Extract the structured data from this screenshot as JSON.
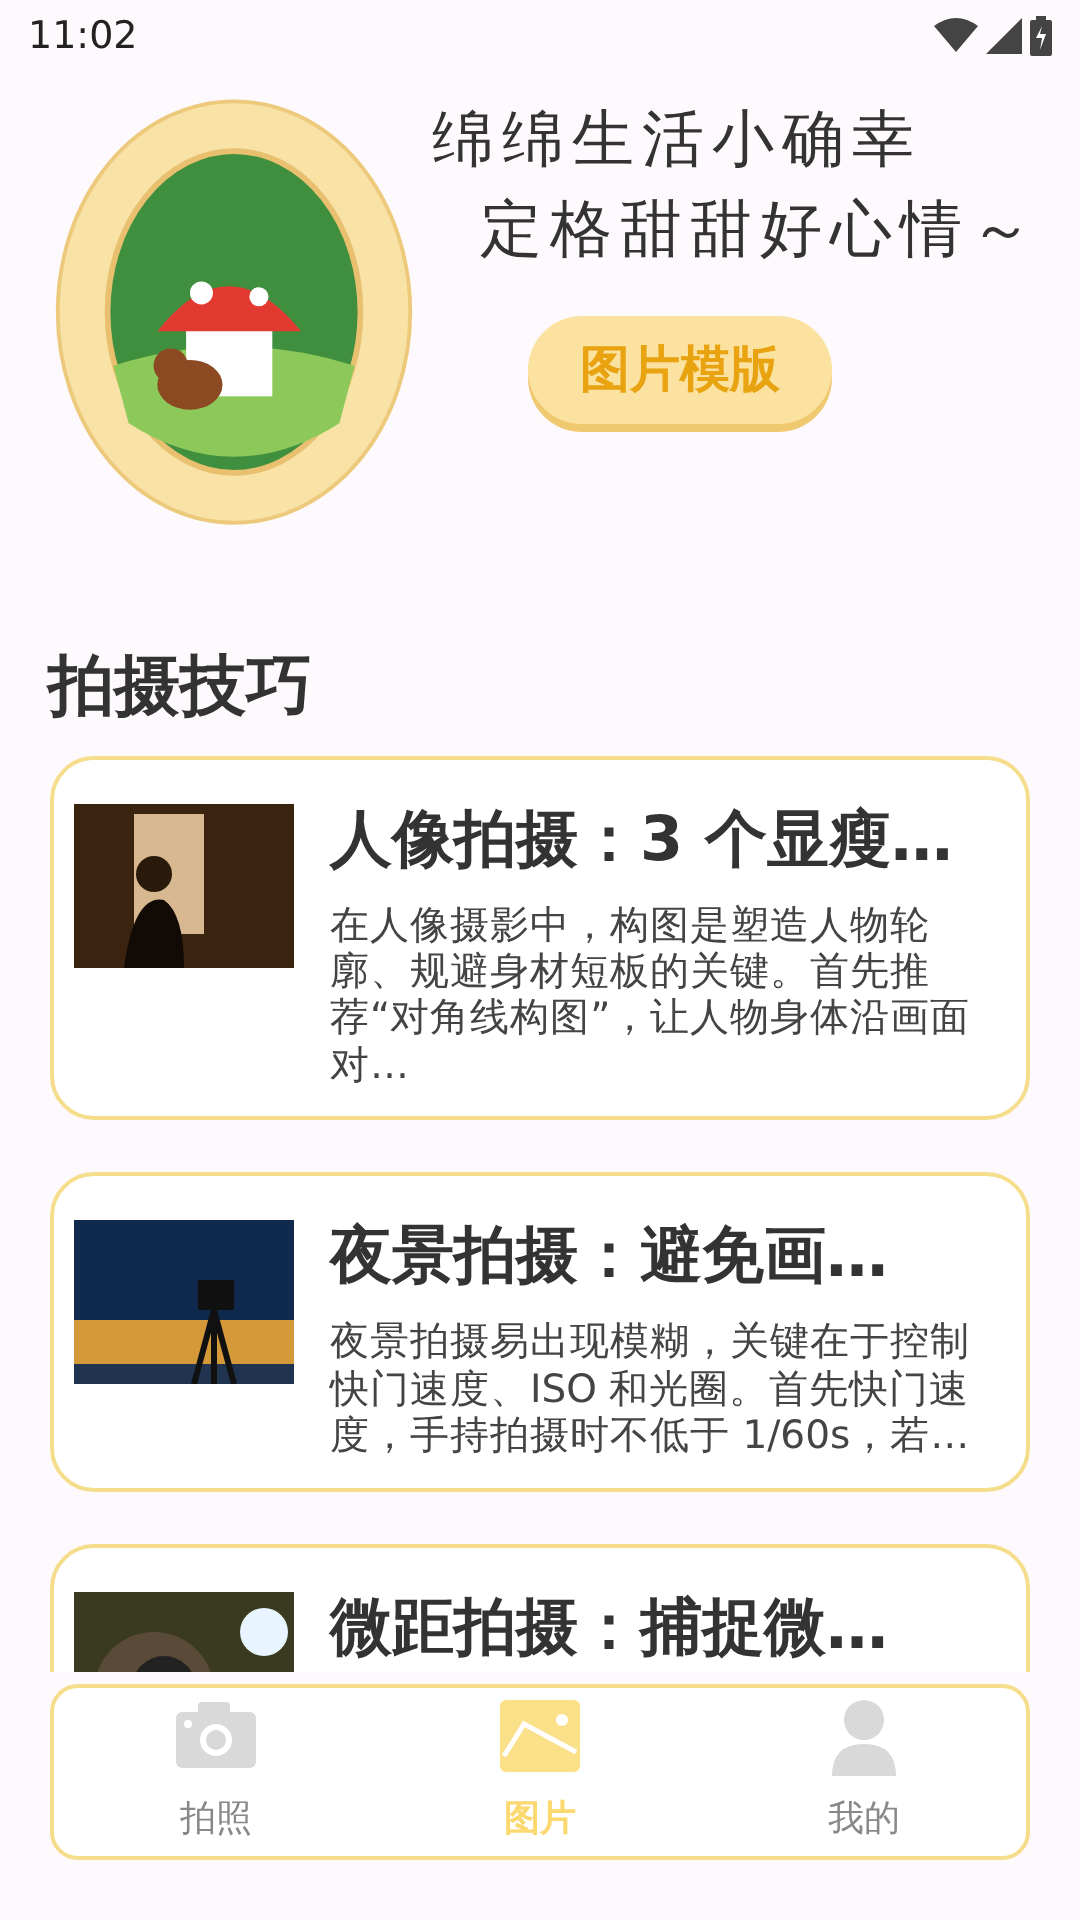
{
  "status_bar": {
    "time": "11:02"
  },
  "banner": {
    "slogan_lines": [
      "绵绵生活小确幸",
      "定格甜甜好心情～"
    ],
    "button": "图片模版"
  },
  "section_title": "拍摄技巧",
  "cards": [
    {
      "title": "人像拍摄：3 个显瘦…",
      "description": "在人像摄影中，构图是塑造人物轮廓、规避身材短板的关键。首先推荐“对角线构图”，让人物身体沿画面对…",
      "kind": "portrait"
    },
    {
      "title": "夜景拍摄：避免画…",
      "description": "夜景拍摄易出现模糊，关键在于控制快门速度、ISO 和光圈。首先快门速度，手持拍摄时不低于 1/60s，若…",
      "kind": "night"
    },
    {
      "title": "微距拍摄：捕捉微…",
      "kind": "macro"
    }
  ],
  "tabs": [
    {
      "label": "拍照",
      "kind": "camera",
      "selected": false
    },
    {
      "label": "图片",
      "kind": "image",
      "selected": true
    },
    {
      "label": "我的",
      "kind": "person",
      "selected": false
    }
  ]
}
